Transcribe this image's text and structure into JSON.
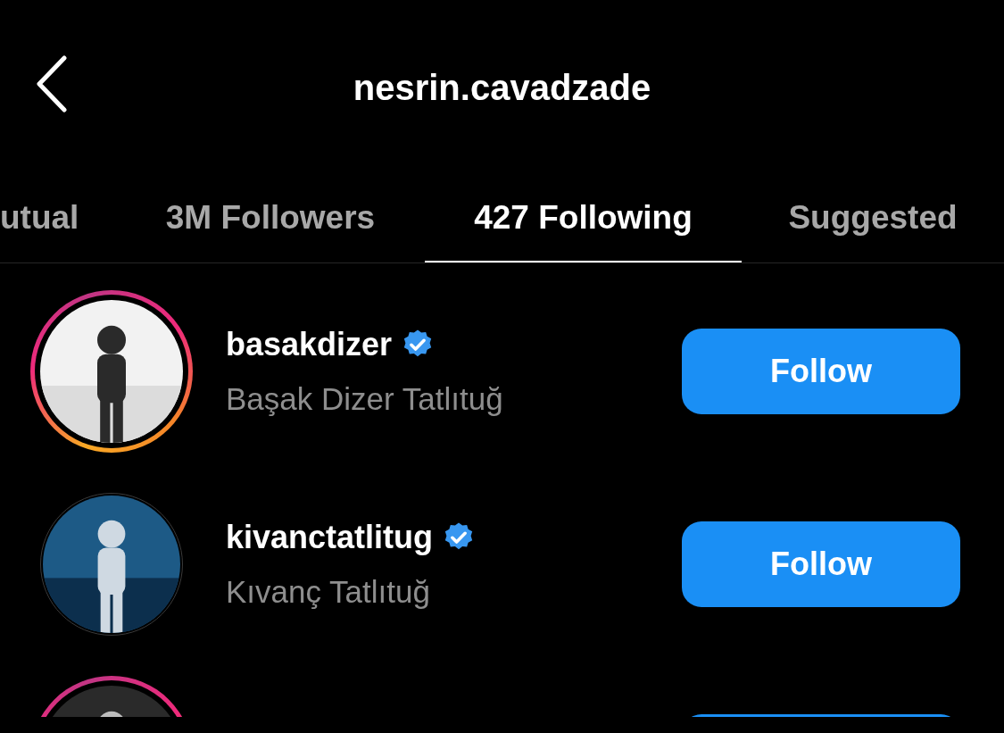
{
  "header": {
    "title": "nesrin.cavadzade"
  },
  "tabs": [
    {
      "label": "utual",
      "selected": false
    },
    {
      "label": "3M Followers",
      "selected": false
    },
    {
      "label": "427 Following",
      "selected": true
    },
    {
      "label": "Suggested",
      "selected": false
    }
  ],
  "rows": [
    {
      "username": "basakdizer",
      "verified": true,
      "full_name": "Başak Dizer Tatlıtuğ",
      "story": true,
      "button": "Follow"
    },
    {
      "username": "kivanctatlitug",
      "verified": true,
      "full_name": "Kıvanç Tatlıtuğ",
      "story": false,
      "button": "Follow"
    },
    {
      "story": true
    }
  ]
}
